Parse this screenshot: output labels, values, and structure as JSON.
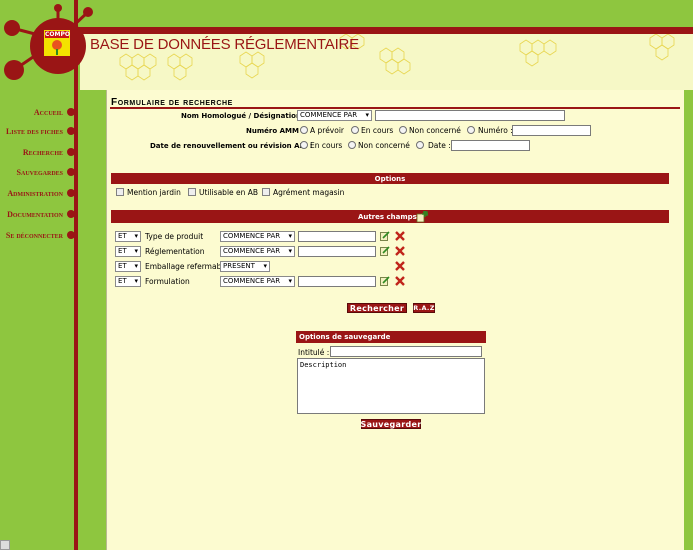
{
  "app": {
    "logo_text": "COMPO",
    "title": "BASE DE DONNÉES RÉGLEMENTAIRE"
  },
  "colors": {
    "brand_red": "#9a1515",
    "page_green": "#8ec63f",
    "panel_bg": "#fcfbd0"
  },
  "nav": {
    "items": [
      {
        "label": "Accueil"
      },
      {
        "label": "Liste des fiches"
      },
      {
        "label": "Recherche"
      },
      {
        "label": "Sauvegardes"
      },
      {
        "label": "Administration"
      },
      {
        "label": "Documentation"
      },
      {
        "label": "Se déconnecter"
      }
    ]
  },
  "form": {
    "title": "Formulaire de recherche",
    "homologue": {
      "label": "Nom Homologué  / Désignation :",
      "operator": "COMMENCE PAR",
      "value": ""
    },
    "amm": {
      "label": "Numéro AMM :",
      "options": [
        "A prévoir",
        "En cours",
        "Non concerné",
        "Numéro :"
      ],
      "value": ""
    },
    "renewal": {
      "label": "Date de renouvellement ou révision AIII :",
      "options": [
        "En cours",
        "Non concerné",
        "Date :"
      ],
      "value": ""
    }
  },
  "options": {
    "header": "Options",
    "checkboxes": [
      "Mention jardin",
      "Utilisable en AB",
      "Agrément magasin"
    ]
  },
  "other_fields": {
    "header": "Autres champs :",
    "add_icon": "add-field-icon",
    "rows": [
      {
        "conj": "ET",
        "field": "Type de produit",
        "operator": "COMMENCE PAR",
        "has_input": true,
        "value": ""
      },
      {
        "conj": "ET",
        "field": "Réglementation",
        "operator": "COMMENCE PAR",
        "has_input": true,
        "value": ""
      },
      {
        "conj": "ET",
        "field": "Emballage refermable",
        "operator": "PRESENT",
        "has_input": false,
        "value": ""
      },
      {
        "conj": "ET",
        "field": "Formulation",
        "operator": "COMMENCE PAR",
        "has_input": true,
        "value": ""
      }
    ]
  },
  "actions": {
    "search": "Rechercher",
    "reset": "R.A.Z"
  },
  "save": {
    "header": "Options de sauvegarde",
    "title_label": "Intitulé :",
    "title_value": "",
    "description": "Description",
    "button": "Sauvegarder"
  }
}
